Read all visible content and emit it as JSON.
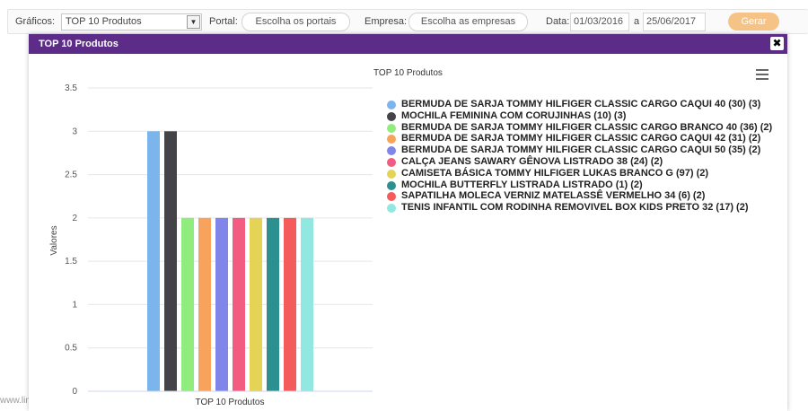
{
  "toolbar": {
    "graficos_label": "Gráficos:",
    "graficos_value": "TOP 10 Produtos",
    "portal_label": "Portal:",
    "portal_placeholder": "Escolha os portais",
    "empresa_label": "Empresa:",
    "empresa_placeholder": "Escolha as empresas",
    "data_label": "Data:",
    "date_from": "01/03/2016",
    "date_sep": "a",
    "date_to": "25/06/2017",
    "gerar_label": "Gerar"
  },
  "modal": {
    "title": "TOP 10 Produtos",
    "close_glyph": "✖"
  },
  "footer": {
    "text": "www.linx.c"
  },
  "icons": {
    "menu": "hamburger-menu-icon",
    "close": "close-icon",
    "dropdown": "chevron-down-icon"
  },
  "chart_data": {
    "type": "bar",
    "title": "TOP 10 Produtos",
    "xlabel": "",
    "ylabel": "Valores",
    "categories": [
      "TOP 10 Produtos"
    ],
    "ylim": [
      0,
      3.5
    ],
    "yticks": [
      "0",
      "0.5",
      "1",
      "1.5",
      "2",
      "2.5",
      "3",
      "3.5"
    ],
    "grid": true,
    "legend_position": "right",
    "series": [
      {
        "name": "BERMUDA DE SARJA TOMMY HILFIGER CLASSIC CARGO CAQUI 40 (30) (3)",
        "values": [
          3
        ],
        "color": "#7cb5ec"
      },
      {
        "name": "MOCHILA FEMININA COM CORUJINHAS (10) (3)",
        "values": [
          3
        ],
        "color": "#434348"
      },
      {
        "name": "BERMUDA DE SARJA TOMMY HILFIGER CLASSIC CARGO BRANCO 40 (36) (2)",
        "values": [
          2
        ],
        "color": "#90ed7d"
      },
      {
        "name": "BERMUDA DE SARJA TOMMY HILFIGER CLASSIC CARGO CAQUI 42 (31) (2)",
        "values": [
          2
        ],
        "color": "#f7a35c"
      },
      {
        "name": "BERMUDA DE SARJA TOMMY HILFIGER CLASSIC CARGO CAQUI 50 (35) (2)",
        "values": [
          2
        ],
        "color": "#8085e9"
      },
      {
        "name": "CALÇA JEANS SAWARY GÊNOVA LISTRADO 38 (24) (2)",
        "values": [
          2
        ],
        "color": "#f15c80"
      },
      {
        "name": "CAMISETA BÁSICA TOMMY HILFIGER LUKAS BRANCO G (97) (2)",
        "values": [
          2
        ],
        "color": "#e4d354"
      },
      {
        "name": "MOCHILA BUTTERFLY LISTRADA LISTRADO (1) (2)",
        "values": [
          2
        ],
        "color": "#2b908f"
      },
      {
        "name": "SAPATILHA MOLECA VERNIZ MATELASSÊ VERMELHO 34 (6) (2)",
        "values": [
          2
        ],
        "color": "#f45b5b"
      },
      {
        "name": "TENIS INFANTIL COM RODINHA REMOVIVEL BOX KIDS PRETO 32 (17) (2)",
        "values": [
          2
        ],
        "color": "#91e8e1"
      }
    ]
  }
}
